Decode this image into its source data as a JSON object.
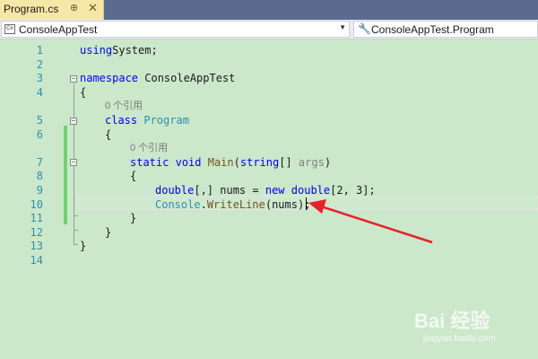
{
  "tab": {
    "title": "Program.cs",
    "pin_glyph": "⊕",
    "close_glyph": "✕"
  },
  "navbar": {
    "project": "ConsoleAppTest",
    "member": "ConsoleAppTest.Program",
    "csharp_icon_text": "C#"
  },
  "editor": {
    "lines": [
      {
        "n": "1",
        "tokens": [
          [
            "kw",
            "using"
          ],
          [
            "",
            "System;"
          ]
        ]
      },
      {
        "n": "2",
        "tokens": []
      },
      {
        "n": "3",
        "tokens": [
          [
            "kw",
            "namespace"
          ],
          [
            "",
            " ConsoleAppTest"
          ]
        ]
      },
      {
        "n": "4",
        "tokens": [
          [
            "",
            "{"
          ]
        ]
      },
      {
        "hint": "0 个引用"
      },
      {
        "n": "5",
        "tokens": [
          [
            "kw",
            "class"
          ],
          [
            "",
            " "
          ],
          [
            "type",
            "Program"
          ]
        ]
      },
      {
        "n": "6",
        "tokens": [
          [
            "",
            "{"
          ]
        ]
      },
      {
        "hint": "0 个引用"
      },
      {
        "n": "7",
        "tokens": [
          [
            "kw",
            "static"
          ],
          [
            "",
            " "
          ],
          [
            "kw",
            "void"
          ],
          [
            "",
            " "
          ],
          [
            "fn",
            "Main"
          ],
          [
            "",
            "("
          ],
          [
            "kw",
            "string"
          ],
          [
            "",
            "[] "
          ],
          [
            "gray",
            "args"
          ],
          [
            "",
            ")"
          ]
        ]
      },
      {
        "n": "8",
        "tokens": [
          [
            "",
            "{"
          ]
        ]
      },
      {
        "n": "9",
        "tokens": [
          [
            "kw",
            "double"
          ],
          [
            "",
            "[,] nums = "
          ],
          [
            "kw",
            "new"
          ],
          [
            "",
            " "
          ],
          [
            "kw",
            "double"
          ],
          [
            "",
            "[2, 3];"
          ]
        ]
      },
      {
        "n": "10",
        "tokens": [
          [
            "type",
            "Console"
          ],
          [
            "",
            "."
          ],
          [
            "fn",
            "WriteLine"
          ],
          [
            "",
            "(nums);"
          ]
        ]
      },
      {
        "n": "11",
        "tokens": [
          [
            "",
            "}"
          ]
        ]
      },
      {
        "n": "12",
        "tokens": [
          [
            "",
            "}"
          ]
        ]
      },
      {
        "n": "13",
        "tokens": [
          [
            "",
            "}"
          ]
        ]
      },
      {
        "n": "14",
        "tokens": []
      }
    ]
  },
  "watermark": {
    "logo": "Bai 经验",
    "url": "jingyan.baidu.com"
  },
  "colors": {
    "editor_bg": "#cbe8cb",
    "keyword": "#0000ff",
    "type": "#2b91af",
    "method": "#74531f",
    "arrow": "#e8202a"
  }
}
